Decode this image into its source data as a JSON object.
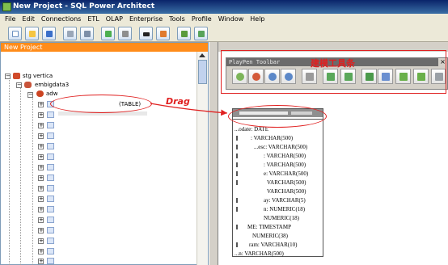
{
  "window": {
    "title": "New Project - SQL Power Architect"
  },
  "menu": [
    "File",
    "Edit",
    "Connections",
    "ETL",
    "OLAP",
    "Enterprise",
    "Tools",
    "Profile",
    "Window",
    "Help"
  ],
  "toolbar_icons": [
    "new-project-icon",
    "open-project-icon",
    "save-icon",
    "refresh-icon",
    "print-icon",
    "zoom-icon",
    "undo-icon",
    "redo-icon",
    "sql-icon",
    "database-icon",
    "compare-icon",
    "report-icon"
  ],
  "project_panel": {
    "header": "New Project",
    "tree": [
      {
        "label": "stg vertica",
        "icon": "database-icon"
      },
      {
        "label": "embigdata3",
        "icon": "catalog-icon"
      },
      {
        "label": "adw",
        "icon": "schema-icon"
      },
      {
        "label": "(TABLE)",
        "icon": "table-icon"
      }
    ]
  },
  "playpen_toolbar": {
    "title": "PlayPen Toolbar",
    "close": "×",
    "annotation": "建模工具条",
    "buttons": [
      "zoom-in-icon",
      "zoom-out-icon",
      "zoom-normal-icon",
      "zoom-fit-icon",
      "select-all-icon",
      "new-table-icon",
      "new-view-icon",
      "insert-column-icon",
      "edit-table-icon",
      "new-relationship-icon",
      "new-identifying-relationship-icon",
      "expand-icon"
    ]
  },
  "drag_annotation": "Drag",
  "table_columns": [
    "...odate: DATE",
    ": VARCHAR(500)",
    "...esc: VARCHAR(500)",
    ": VARCHAR(500)",
    ": VARCHAR(500)",
    "e: VARCHAR(500)",
    "VARCHAR(500)",
    "VARCHAR(500)",
    "ay: VARCHAR(5)",
    "n: NUMERIC(18)",
    "NUMERIC(18)",
    "ME: TIMESTAMP",
    "NUMERIC(38)",
    "ram: VARCHAR(10)",
    "...n: VARCHAR(500)"
  ],
  "colors": {
    "accent_orange": "#ff8c1a",
    "annotation_red": "#e02020",
    "title_blue": "#0a246a"
  }
}
